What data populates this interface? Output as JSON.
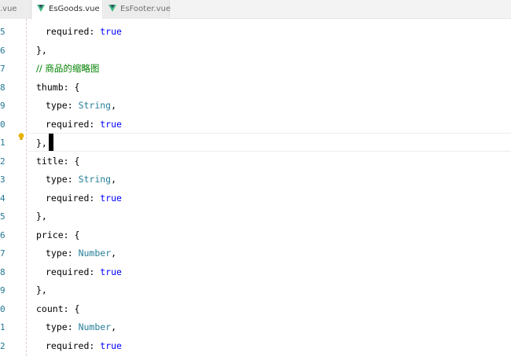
{
  "tabs": [
    {
      "label": ".vue",
      "active": false
    },
    {
      "label": "EsGoods.vue",
      "active": true,
      "dirty": true
    },
    {
      "label": "EsFooter.vue",
      "active": false
    }
  ],
  "gutter": [
    "5",
    "6",
    "7",
    "8",
    "9",
    "0",
    "1",
    "2",
    "3",
    "4",
    "5",
    "6",
    "7",
    "8",
    "9",
    "0",
    "1",
    "2"
  ],
  "code": {
    "l0": {
      "key": "required",
      "colon": ": ",
      "value": "true"
    },
    "l1": {
      "text": "},"
    },
    "l2": {
      "text": "// 商品的缩略图"
    },
    "l3": {
      "text": "thumb: {"
    },
    "l4": {
      "key": "type",
      "colon": ": ",
      "value": "String",
      "tail": ","
    },
    "l5": {
      "key": "required",
      "colon": ": ",
      "value": "true"
    },
    "l6": {
      "text": "},"
    },
    "l7": {
      "text": "title: {"
    },
    "l8": {
      "key": "type",
      "colon": ": ",
      "value": "String",
      "tail": ","
    },
    "l9": {
      "key": "required",
      "colon": ": ",
      "value": "true"
    },
    "l10": {
      "text": "},"
    },
    "l11": {
      "text": "price: {"
    },
    "l12": {
      "key": "type",
      "colon": ": ",
      "value": "Number",
      "tail": ","
    },
    "l13": {
      "key": "required",
      "colon": ": ",
      "value": "true"
    },
    "l14": {
      "text": "},"
    },
    "l15": {
      "text": "count: {"
    },
    "l16": {
      "key": "type",
      "colon": ": ",
      "value": "Number",
      "tail": ","
    },
    "l17": {
      "key": "required",
      "colon": ": ",
      "value": "true"
    }
  },
  "colors": {
    "keyword_true": "#0000ff",
    "type_name": "#267f99",
    "comment": "#008000",
    "line_number": "#237893",
    "lightbulb": "#e8b400"
  },
  "icons": [
    "vue-file-icon",
    "lightbulb-icon"
  ]
}
